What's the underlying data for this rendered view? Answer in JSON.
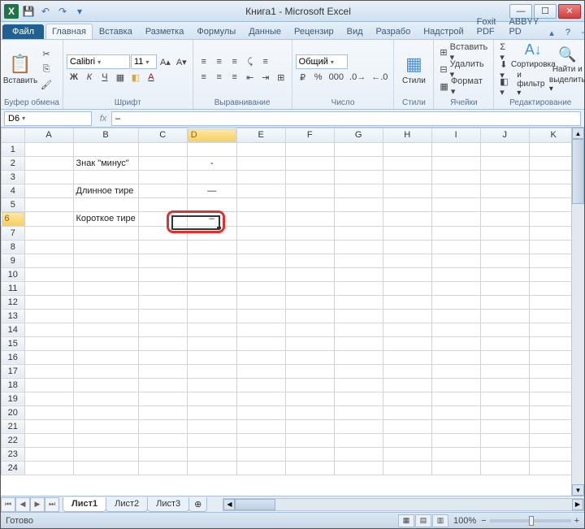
{
  "title": "Книга1 - Microsoft Excel",
  "qat": {
    "excel_icon": "X",
    "save": "💾",
    "undo": "↶",
    "redo": "↷"
  },
  "tabs": {
    "file": "Файл",
    "items": [
      "Главная",
      "Вставка",
      "Разметка",
      "Формулы",
      "Данные",
      "Рецензир",
      "Вид",
      "Разрабо",
      "Надстрой",
      "Foxit PDF",
      "ABBYY PD"
    ]
  },
  "ribbon": {
    "clipboard": {
      "paste": "Вставить",
      "label": "Буфер обмена"
    },
    "font": {
      "name": "Calibri",
      "size": "11",
      "label": "Шрифт"
    },
    "align": {
      "label": "Выравнивание",
      "wrap": "≡",
      "merge": "⊞"
    },
    "number": {
      "format": "Общий",
      "label": "Число"
    },
    "styles": {
      "btn": "Стили",
      "label": "Стили"
    },
    "cells": {
      "insert": "Вставить ▾",
      "delete": "Удалить ▾",
      "format": "Формат ▾",
      "label": "Ячейки"
    },
    "editing": {
      "sort": "Сортировка",
      "sort2": "и фильтр ▾",
      "find": "Найти и",
      "find2": "выделить ▾",
      "label": "Редактирование"
    }
  },
  "namebox": "D6",
  "fx_label": "fx",
  "formula": "–",
  "cols": [
    "A",
    "B",
    "C",
    "D",
    "E",
    "F",
    "G",
    "H",
    "I",
    "J",
    "K"
  ],
  "rows": [
    "1",
    "2",
    "3",
    "4",
    "5",
    "6",
    "7",
    "8",
    "9",
    "10",
    "11",
    "12",
    "13",
    "14",
    "15",
    "16",
    "17",
    "18",
    "19",
    "20",
    "21",
    "22",
    "23",
    "24"
  ],
  "cells": {
    "b2": "Знак \"минус\"",
    "d2": "-",
    "b4": "Длинное тире",
    "d4": "—",
    "b6": "Короткое тире",
    "d6": "–"
  },
  "sheets": [
    "Лист1",
    "Лист2",
    "Лист3"
  ],
  "status": "Готово",
  "zoom": "100%",
  "winbtns": {
    "min": "—",
    "max": "☐",
    "close": "✕"
  }
}
